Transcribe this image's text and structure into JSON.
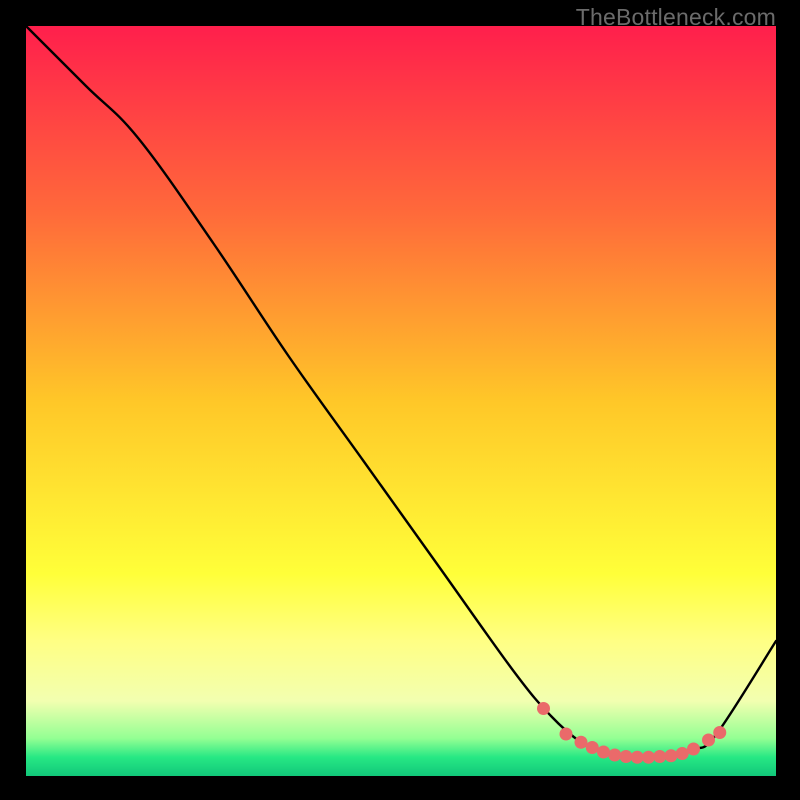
{
  "watermark": "TheBottleneck.com",
  "chart_data": {
    "type": "line",
    "title": "",
    "xlabel": "",
    "ylabel": "",
    "xlim": [
      0,
      100
    ],
    "ylim": [
      0,
      100
    ],
    "grid": false,
    "series": [
      {
        "name": "curve",
        "color_hex": "#000000",
        "x": [
          0,
          8,
          15,
          25,
          35,
          45,
          55,
          65,
          70,
          74,
          77,
          80,
          83,
          86,
          89,
          92,
          100
        ],
        "y": [
          100,
          92,
          85,
          71,
          56,
          42,
          28,
          14,
          8,
          4.5,
          3.2,
          2.6,
          2.5,
          2.7,
          3.6,
          5.5,
          18
        ]
      }
    ],
    "markers": {
      "name": "dots",
      "color_hex": "#ea6a6a",
      "x": [
        69,
        72,
        74,
        75.5,
        77,
        78.5,
        80,
        81.5,
        83,
        84.5,
        86,
        87.5,
        89,
        91,
        92.5
      ],
      "y": [
        9.0,
        5.6,
        4.5,
        3.8,
        3.2,
        2.8,
        2.6,
        2.5,
        2.5,
        2.6,
        2.7,
        3.0,
        3.6,
        4.8,
        5.8
      ]
    },
    "background": {
      "type": "vertical-gradient",
      "stops": [
        {
          "offset": 0.0,
          "color": "#ff1f4c"
        },
        {
          "offset": 0.25,
          "color": "#ff6a3a"
        },
        {
          "offset": 0.5,
          "color": "#ffc728"
        },
        {
          "offset": 0.73,
          "color": "#ffff39"
        },
        {
          "offset": 0.82,
          "color": "#ffff84"
        },
        {
          "offset": 0.9,
          "color": "#f2ffb0"
        },
        {
          "offset": 0.95,
          "color": "#93ff93"
        },
        {
          "offset": 0.975,
          "color": "#27e884"
        },
        {
          "offset": 1.0,
          "color": "#11c77a"
        }
      ]
    }
  }
}
